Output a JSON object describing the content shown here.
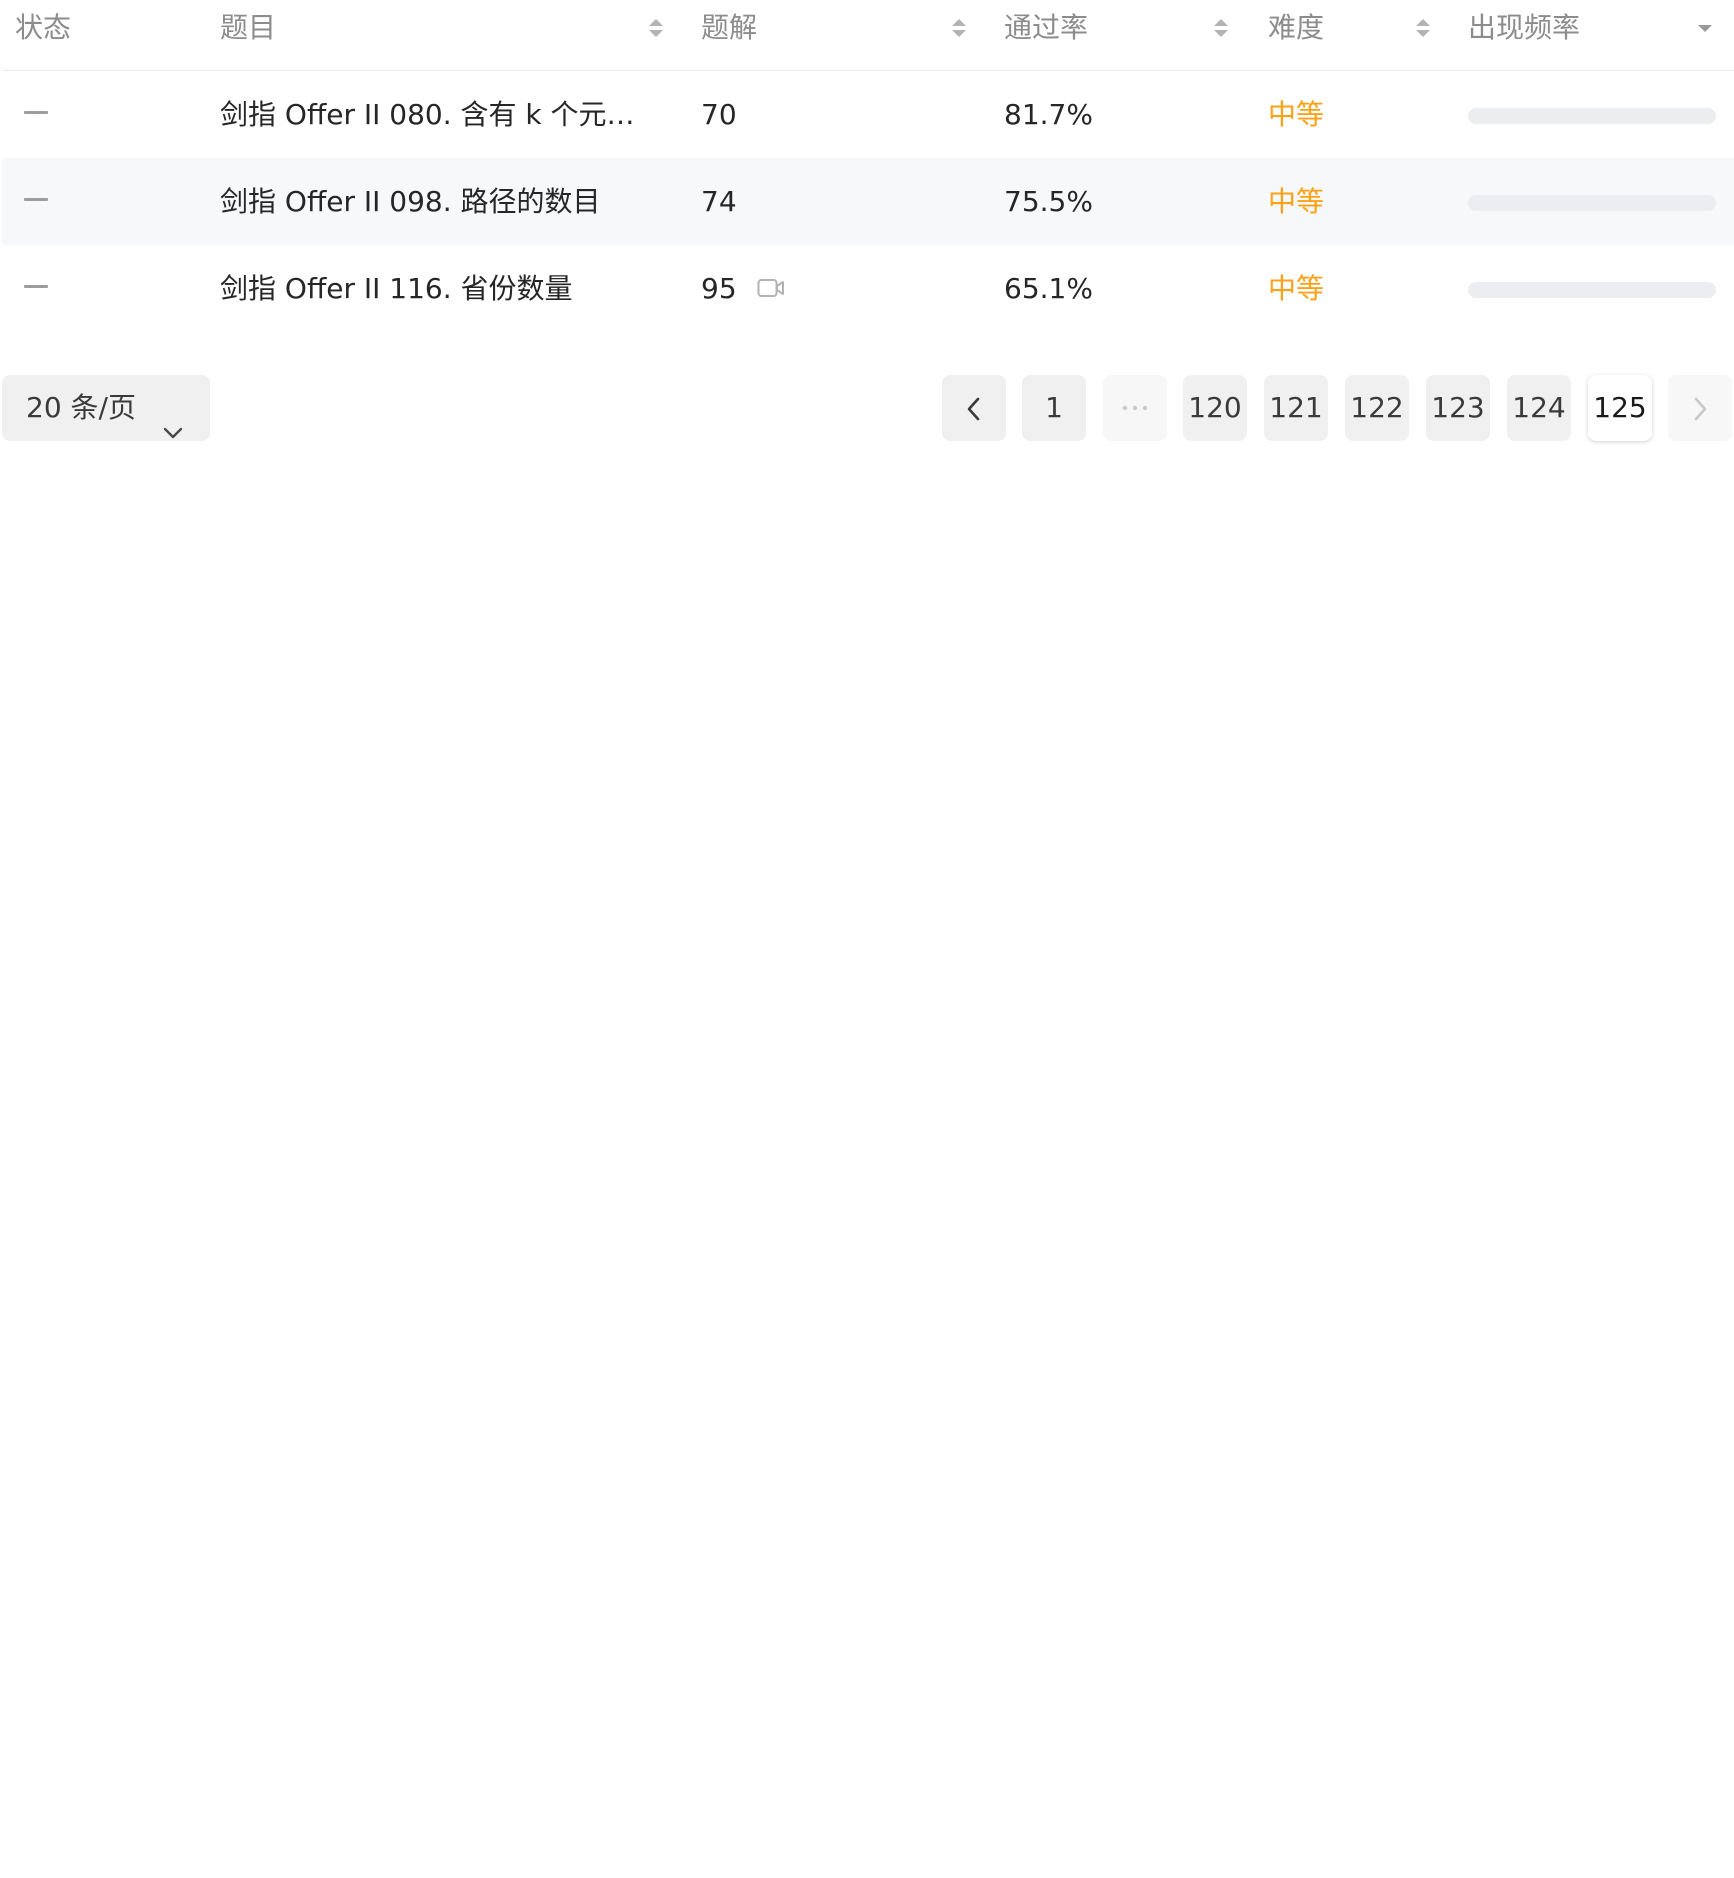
{
  "table": {
    "headers": {
      "status": "状态",
      "title": "题目",
      "solutions": "题解",
      "acceptance": "通过率",
      "difficulty": "难度",
      "frequency": "出现频率"
    },
    "rows": [
      {
        "status": "—",
        "title": "剑指 Offer II 080. 含有 k 个元素...",
        "solutions": "70",
        "has_video": false,
        "acceptance": "81.7%",
        "difficulty": "中等",
        "frequency": 0.0
      },
      {
        "status": "—",
        "title": "剑指 Offer II 098. 路径的数目",
        "solutions": "74",
        "has_video": false,
        "acceptance": "75.5%",
        "difficulty": "中等",
        "frequency": 0.0
      },
      {
        "status": "—",
        "title": "剑指 Offer II 116. 省份数量",
        "solutions": "95",
        "has_video": true,
        "acceptance": "65.1%",
        "difficulty": "中等",
        "frequency": 0.0
      }
    ]
  },
  "pagination": {
    "page_size_label": "20 条/页",
    "pages": [
      "1",
      "120",
      "121",
      "122",
      "123",
      "124",
      "125"
    ],
    "current_page": "125"
  },
  "colors": {
    "difficulty_medium": "#ffa116",
    "header_text": "#8c8c8c",
    "row_alt_bg": "#f7f8fa"
  },
  "icons": {
    "sort": "sort-arrows-icon",
    "sort_desc": "caret-down-icon",
    "video": "video-camera-icon",
    "prev": "chevron-left-icon",
    "next": "chevron-right-icon",
    "ellipsis": "ellipsis-icon",
    "dropdown": "chevron-down-icon"
  }
}
